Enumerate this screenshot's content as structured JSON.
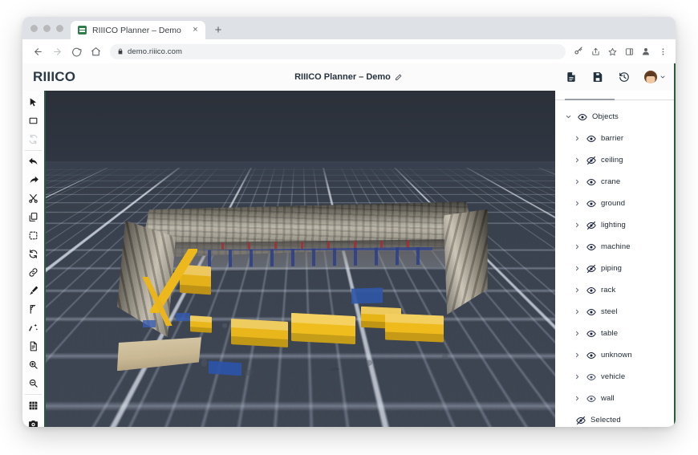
{
  "browser": {
    "tab": {
      "title": "RIIICO Planner – Demo",
      "favicon": "green-square-favicon",
      "close": "×"
    },
    "new_tab": "+",
    "nav": {
      "back": "back-arrow",
      "forward": "forward-arrow",
      "reload": "reload-arrow",
      "home": "home-icon"
    },
    "url": "demo.riiico.com",
    "url_lock": "lock-icon",
    "omni_icons": [
      "key-icon",
      "share-icon",
      "star-icon",
      "sidepanel-icon",
      "profile-icon",
      "menu-kebab-icon"
    ]
  },
  "app": {
    "logo": "RIIICO",
    "title": "RIIICO Planner – Demo",
    "title_edit_icon": "pencil-icon",
    "header_actions": [
      {
        "name": "new-document",
        "icon": "document-icon"
      },
      {
        "name": "save",
        "icon": "floppy-save-icon"
      },
      {
        "name": "history",
        "icon": "clock-history-icon"
      }
    ],
    "avatar": {
      "name": "user-avatar",
      "chevron": "chevron-down-icon"
    }
  },
  "toolbar": {
    "items": [
      {
        "name": "select-tool",
        "icon": "cursor-arrow-icon",
        "state": "active"
      },
      {
        "name": "rectangle-tool",
        "icon": "rectangle-icon",
        "state": "normal"
      },
      {
        "name": "reset-view",
        "icon": "refresh-icon",
        "state": "disabled"
      },
      {
        "name": "undo",
        "icon": "undo-arrow-icon",
        "state": "normal"
      },
      {
        "name": "redo",
        "icon": "redo-arrow-icon",
        "state": "normal"
      },
      {
        "name": "cut",
        "icon": "scissors-icon",
        "state": "normal"
      },
      {
        "name": "copy",
        "icon": "copy-icon",
        "state": "normal"
      },
      {
        "name": "select-region",
        "icon": "dashed-frame-icon",
        "state": "normal"
      },
      {
        "name": "rotate",
        "icon": "rotate-icon",
        "state": "normal"
      },
      {
        "name": "link",
        "icon": "chain-link-icon",
        "state": "normal"
      },
      {
        "name": "paint",
        "icon": "brush-icon",
        "state": "normal"
      },
      {
        "name": "measure",
        "icon": "corner-ruler-icon",
        "state": "normal"
      },
      {
        "name": "magic-wand",
        "icon": "magic-wand-icon",
        "state": "normal"
      },
      {
        "name": "notes",
        "icon": "file-lines-icon",
        "state": "normal"
      },
      {
        "name": "zoom-in",
        "icon": "magnifier-plus-icon",
        "state": "normal"
      },
      {
        "name": "zoom-out",
        "icon": "magnifier-minus-icon",
        "state": "normal"
      },
      {
        "name": "toggle-grid",
        "icon": "grid-icon",
        "state": "toggled"
      },
      {
        "name": "screenshot",
        "icon": "camera-icon",
        "state": "toggled"
      },
      {
        "name": "lock",
        "icon": "unlock-icon",
        "state": "toggled"
      }
    ]
  },
  "viewport": {
    "name": "3d-scene-viewport",
    "description": "3D point-cloud scan of a factory hall on an infinite perspective grid"
  },
  "panel": {
    "tree": [
      {
        "label": "Objects",
        "level": 0,
        "chevron": "chevron-down",
        "visibility": "visible"
      },
      {
        "label": "barrier",
        "level": 1,
        "chevron": "chevron-right",
        "visibility": "visible"
      },
      {
        "label": "ceiling",
        "level": 1,
        "chevron": "chevron-right",
        "visibility": "hidden"
      },
      {
        "label": "crane",
        "level": 1,
        "chevron": "chevron-right",
        "visibility": "visible"
      },
      {
        "label": "ground",
        "level": 1,
        "chevron": "chevron-right",
        "visibility": "visible"
      },
      {
        "label": "lighting",
        "level": 1,
        "chevron": "chevron-right",
        "visibility": "hidden"
      },
      {
        "label": "machine",
        "level": 1,
        "chevron": "chevron-right",
        "visibility": "visible"
      },
      {
        "label": "piping",
        "level": 1,
        "chevron": "chevron-right",
        "visibility": "hidden"
      },
      {
        "label": "rack",
        "level": 1,
        "chevron": "chevron-right",
        "visibility": "visible"
      },
      {
        "label": "steel",
        "level": 1,
        "chevron": "chevron-right",
        "visibility": "visible"
      },
      {
        "label": "table",
        "level": 1,
        "chevron": "chevron-right",
        "visibility": "visible"
      },
      {
        "label": "unknown",
        "level": 1,
        "chevron": "chevron-right",
        "visibility": "visible"
      },
      {
        "label": "vehicle",
        "level": 1,
        "chevron": "chevron-right",
        "visibility": "dimmed"
      },
      {
        "label": "wall",
        "level": 1,
        "chevron": "chevron-right",
        "visibility": "dimmed"
      },
      {
        "label": "Selected",
        "level": 2,
        "chevron": "none",
        "visibility": "hidden"
      }
    ]
  },
  "colors": {
    "accent_green": "#2d5941",
    "machine_yellow": "#eeba1c",
    "panel_text": "#202b36",
    "grid_line": "#c3cede"
  }
}
